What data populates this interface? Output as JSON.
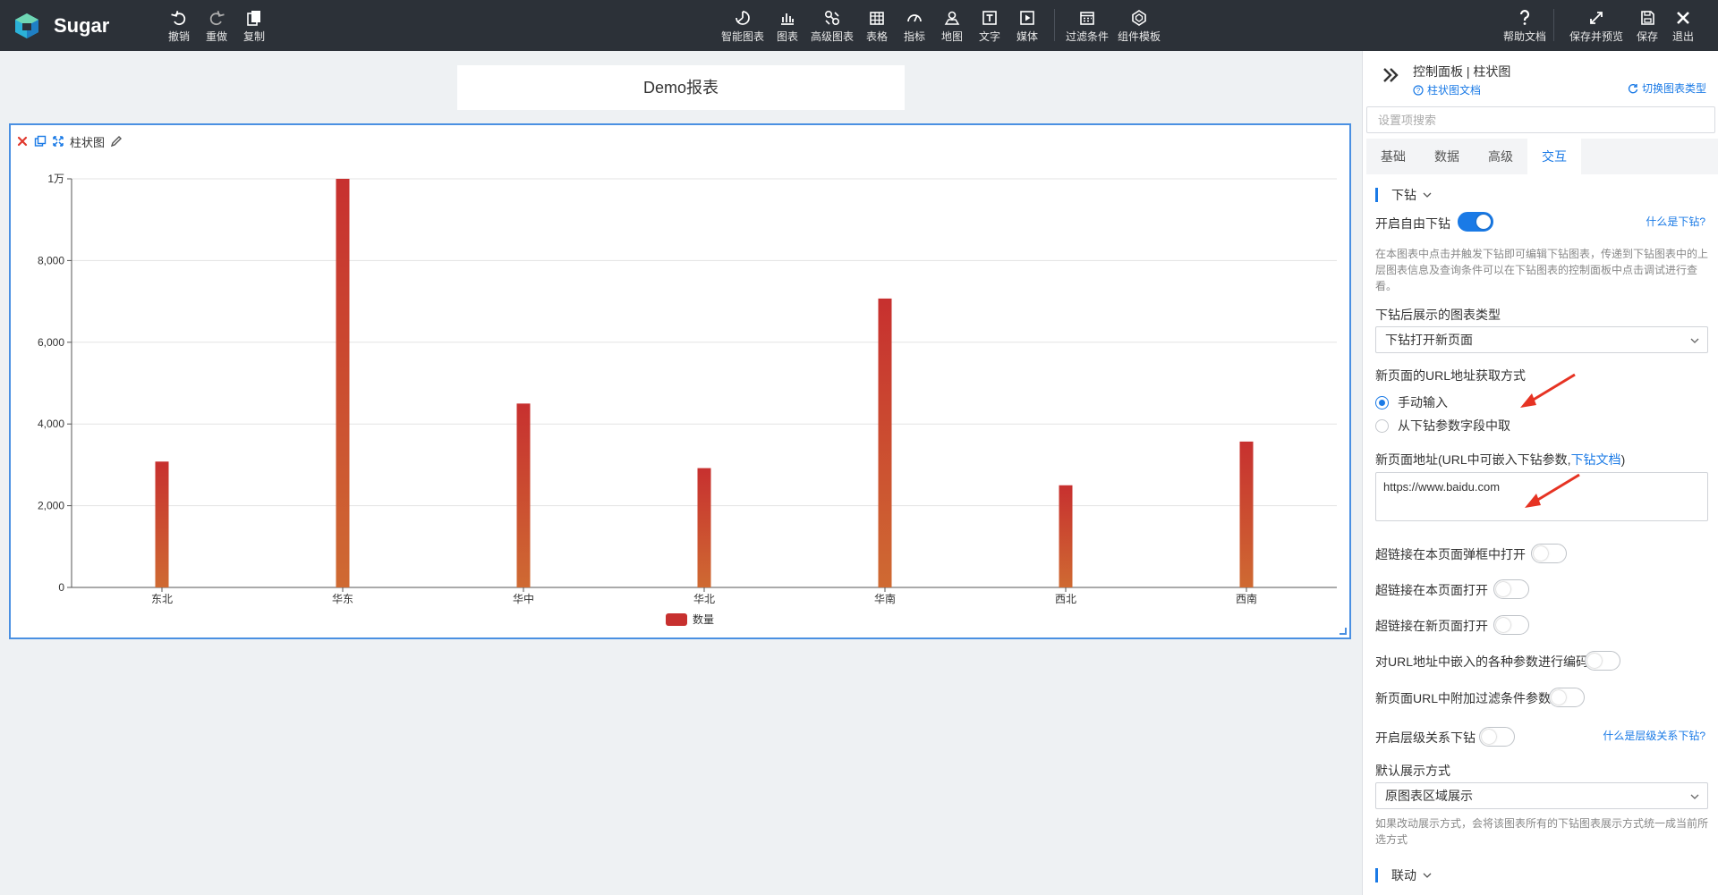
{
  "app": {
    "brand": "Sugar"
  },
  "toolbar_left": [
    {
      "label": "撤销",
      "icon": "undo-icon"
    },
    {
      "label": "重做",
      "icon": "redo-icon"
    },
    {
      "label": "复制",
      "icon": "copy-icon"
    }
  ],
  "toolbar_center": [
    {
      "label": "智能图表",
      "icon": "smart-chart-icon"
    },
    {
      "label": "图表",
      "icon": "chart-icon"
    },
    {
      "label": "高级图表",
      "icon": "advanced-chart-icon"
    },
    {
      "label": "表格",
      "icon": "table-icon"
    },
    {
      "label": "指标",
      "icon": "gauge-icon"
    },
    {
      "label": "地图",
      "icon": "map-icon"
    },
    {
      "label": "文字",
      "icon": "text-icon"
    },
    {
      "label": "媒体",
      "icon": "media-icon"
    },
    {
      "label": "过滤条件",
      "icon": "filter-icon"
    },
    {
      "label": "组件模板",
      "icon": "template-icon"
    }
  ],
  "toolbar_right": [
    {
      "label": "帮助文档",
      "icon": "help-icon"
    },
    {
      "label": "保存并预览",
      "icon": "expand-icon"
    },
    {
      "label": "保存",
      "icon": "save-icon"
    },
    {
      "label": "退出",
      "icon": "close-icon"
    }
  ],
  "report": {
    "title": "Demo报表"
  },
  "widget": {
    "title": "柱状图"
  },
  "chart_data": {
    "type": "bar",
    "categories": [
      "东北",
      "华东",
      "华中",
      "华北",
      "华南",
      "西北",
      "西南"
    ],
    "series": [
      {
        "name": "数量",
        "values": [
          3080,
          10000,
          4500,
          2920,
          7070,
          2500,
          3570
        ]
      }
    ],
    "ylim": [
      0,
      10000
    ],
    "yticks": [
      {
        "value": 0,
        "label": "0"
      },
      {
        "value": 2000,
        "label": "2,000"
      },
      {
        "value": 4000,
        "label": "4,000"
      },
      {
        "value": 6000,
        "label": "6,000"
      },
      {
        "value": 8000,
        "label": "8,000"
      },
      {
        "value": 10000,
        "label": "1万"
      }
    ],
    "grid": true,
    "legend": "bottom-center",
    "bar_color_top": "#c7302f",
    "bar_color_bottom": "#cf6a32"
  },
  "panel": {
    "title": "控制面板 | 柱状图",
    "doc_link": "柱状图文档",
    "switch_link": "切换图表类型",
    "search_placeholder": "设置项搜索",
    "tabs": [
      "基础",
      "数据",
      "高级",
      "交互"
    ],
    "active_tab": "交互",
    "drill": {
      "section": "下钻",
      "enable_label": "开启自由下钻",
      "enable_on": true,
      "what_link": "什么是下钻?",
      "description": "在本图表中点击并触发下钻即可编辑下钻图表，传递到下钻图表中的上层图表信息及查询条件可以在下钻图表的控制面板中点击调试进行查看。",
      "type_label": "下钻后展示的图表类型",
      "type_value": "下钻打开新页面",
      "url_method_label": "新页面的URL地址获取方式",
      "radio_manual": "手动输入",
      "radio_field": "从下钻参数字段中取",
      "url_label_prefix": "新页面地址(URL中可嵌入下钻参数,",
      "url_label_link": "下钻文档",
      "url_label_suffix": ")",
      "url_value": "https://www.baidu.com",
      "toggles": [
        {
          "label": "超链接在本页面弹框中打开",
          "on": false
        },
        {
          "label": "超链接在本页面打开",
          "on": false
        },
        {
          "label": "超链接在新页面打开",
          "on": false
        },
        {
          "label": "对URL地址中嵌入的各种参数进行编码",
          "on": false
        },
        {
          "label": "新页面URL中附加过滤条件参数",
          "on": false
        }
      ],
      "hier_label": "开启层级关系下钻",
      "hier_on": false,
      "hier_link": "什么是层级关系下钻?",
      "display_label": "默认展示方式",
      "display_value": "原图表区域展示",
      "display_desc": "如果改动展示方式，会将该图表所有的下钻图表展示方式统一成当前所选方式"
    },
    "linkage": {
      "section": "联动"
    }
  }
}
